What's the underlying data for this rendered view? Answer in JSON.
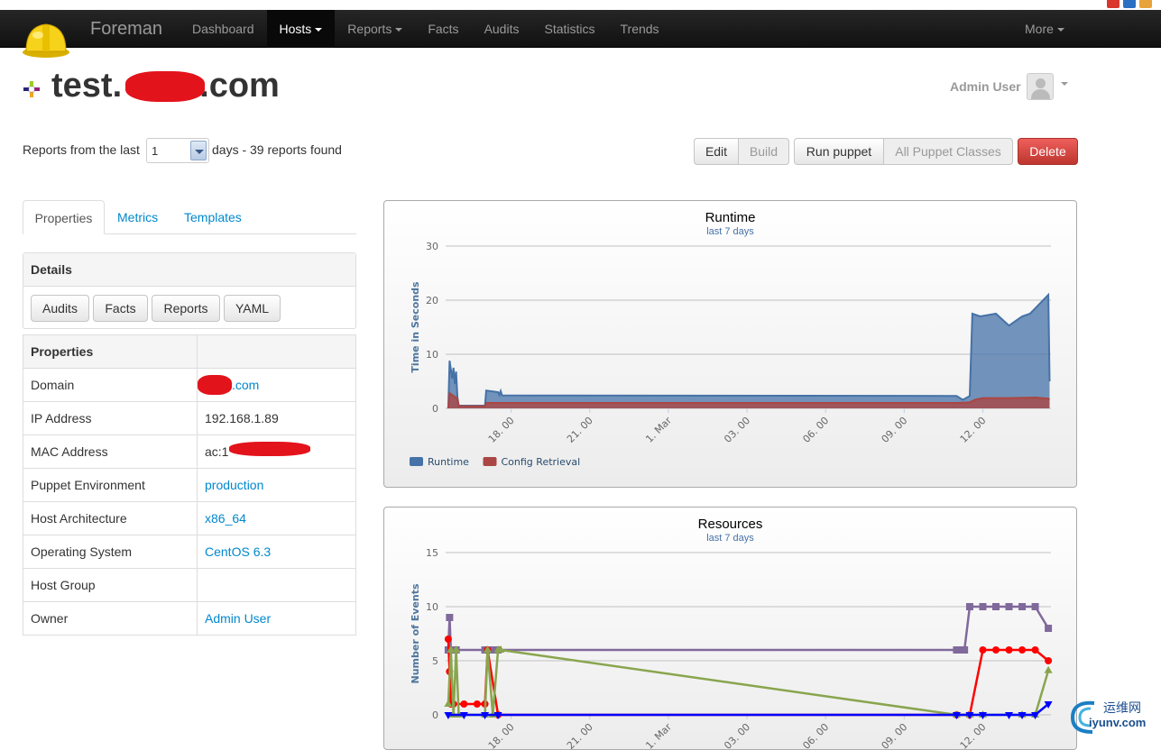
{
  "navbar": {
    "brand": "Foreman",
    "items": [
      {
        "label": "Dashboard",
        "dropdown": false
      },
      {
        "label": "Hosts",
        "dropdown": true,
        "active": true
      },
      {
        "label": "Reports",
        "dropdown": true
      },
      {
        "label": "Facts",
        "dropdown": false
      },
      {
        "label": "Audits",
        "dropdown": false
      },
      {
        "label": "Statistics",
        "dropdown": false
      },
      {
        "label": "Trends",
        "dropdown": false
      }
    ],
    "more": "More"
  },
  "host": {
    "title_prefix": "test.",
    "title_suffix": ".com"
  },
  "user": {
    "name": "Admin User",
    "avatar_icon": "user-avatar-icon"
  },
  "reports_filter": {
    "label": "Reports from the last",
    "value": "1",
    "suffix": "days - 39 reports found"
  },
  "actions": {
    "edit": "Edit",
    "build": "Build",
    "run_puppet": "Run puppet",
    "all_puppet_classes": "All Puppet Classes",
    "delete": "Delete"
  },
  "tabs": [
    "Properties",
    "Metrics",
    "Templates"
  ],
  "details": {
    "heading": "Details",
    "buttons": [
      "Audits",
      "Facts",
      "Reports",
      "YAML"
    ]
  },
  "properties": {
    "heading": "Properties",
    "rows": [
      {
        "key": "Domain",
        "value": ".com",
        "link": true
      },
      {
        "key": "IP Address",
        "value": "192.168.1.89",
        "link": false
      },
      {
        "key": "MAC Address",
        "value": "ac:1",
        "link": false
      },
      {
        "key": "Puppet Environment",
        "value": "production",
        "link": true
      },
      {
        "key": "Host Architecture",
        "value": "x86_64",
        "link": true
      },
      {
        "key": "Operating System",
        "value": "CentOS 6.3",
        "link": true
      },
      {
        "key": "Host Group",
        "value": "",
        "link": false
      },
      {
        "key": "Owner",
        "value": "Admin User",
        "link": true
      }
    ]
  },
  "colors": {
    "runtime": "#4572a7",
    "config_retrieval": "#aa4643",
    "purple": "#80699b",
    "green": "#89a54e",
    "delete": "#da4f49",
    "link": "#0088cc"
  },
  "chart_data": [
    {
      "type": "area",
      "title": "Runtime",
      "subtitle": "last 7 days",
      "ylabel": "Time in Seconds",
      "ylim": [
        0,
        30
      ],
      "yticks": [
        "0",
        "10",
        "20",
        "30"
      ],
      "xticks": [
        "18. 00",
        "21. 00",
        "1. Mar",
        "03. 00",
        "06. 00",
        "09. 00",
        "12. 00"
      ],
      "xrange": [
        15.5,
        38.6
      ],
      "series": [
        {
          "name": "Runtime",
          "x": [
            15.6,
            15.65,
            15.75,
            15.8,
            15.85,
            15.9,
            15.95,
            16.0,
            16.05,
            16.1,
            16.15,
            16.2,
            17.0,
            17.05,
            17.5,
            17.55,
            17.6,
            17.65,
            35.0,
            35.2,
            35.25,
            35.5,
            35.6,
            35.9,
            36.5,
            37.0,
            37.5,
            37.8,
            38.5,
            38.55
          ],
          "y": [
            0,
            8.8,
            5.5,
            7.5,
            4.5,
            6.8,
            2,
            0.5,
            0.5,
            0.5,
            0.5,
            0.5,
            0.5,
            3.3,
            3.0,
            2.5,
            3.2,
            2.4,
            2.3,
            1.7,
            1.6,
            2.3,
            17.5,
            17,
            17.5,
            15.3,
            17,
            17.5,
            21,
            5
          ]
        },
        {
          "name": "Config Retrieval",
          "x": [
            15.6,
            15.65,
            15.8,
            15.95,
            16.0,
            17.0,
            17.05,
            35.0,
            35.5,
            35.7,
            36.0,
            37.0,
            38.0,
            38.5,
            38.55
          ],
          "y": [
            0,
            2.8,
            2.3,
            1.8,
            0.4,
            0.4,
            1.0,
            1.0,
            1.1,
            1.6,
            1.9,
            1.9,
            2.0,
            1.8,
            1.6
          ]
        }
      ],
      "legend": [
        "Runtime",
        "Config Retrieval"
      ]
    },
    {
      "type": "line",
      "title": "Resources",
      "subtitle": "last 7 days",
      "ylabel": "Number of Events",
      "ylim": [
        0,
        15
      ],
      "yticks": [
        "0",
        "5",
        "10",
        "15"
      ],
      "xticks": [
        "18. 00",
        "21. 00",
        "1. Mar",
        "03. 00",
        "06. 00",
        "09. 00",
        "12. 00"
      ],
      "xrange": [
        15.5,
        38.6
      ],
      "series": [
        {
          "name": "",
          "color": "purple",
          "x": [
            15.6,
            15.65,
            15.7,
            15.8,
            15.85,
            15.9,
            17.0,
            17.3,
            17.5,
            35.0,
            35.2,
            35.3,
            35.5,
            36.0,
            36.5,
            37.0,
            37.5,
            38.0,
            38.5
          ],
          "y": [
            6,
            9,
            6,
            6,
            6,
            6,
            6,
            6,
            6,
            6,
            6,
            6,
            10,
            10,
            10,
            10,
            10,
            10,
            8
          ]
        },
        {
          "name": "",
          "color": "red",
          "x": [
            15.6,
            15.65,
            15.7,
            15.8,
            16.2,
            16.7,
            17.0,
            17.1,
            17.5,
            35.0,
            35.5,
            36.0,
            36.5,
            37.0,
            37.5,
            38.0,
            38.5
          ],
          "y": [
            7,
            4,
            1,
            1,
            1,
            1,
            1,
            6,
            0,
            0,
            0,
            6,
            6,
            6,
            6,
            6,
            5
          ]
        },
        {
          "name": "",
          "color": "green",
          "x": [
            15.6,
            15.7,
            15.8,
            15.9,
            16.0,
            17.0,
            17.1,
            17.3,
            17.5,
            17.6,
            35.0,
            35.5,
            36.0,
            37.5,
            38.0,
            38.5
          ],
          "y": [
            1,
            6,
            0,
            6,
            0,
            0,
            6,
            0,
            6,
            6,
            0,
            0,
            0,
            0,
            0,
            4.1
          ]
        },
        {
          "name": "",
          "color": "blue",
          "x": [
            15.6,
            16.2,
            17.0,
            17.5,
            35.0,
            35.5,
            36.0,
            37.0,
            37.5,
            38.0,
            38.5
          ],
          "y": [
            0,
            0,
            0,
            0,
            0,
            0,
            0,
            0,
            0,
            0,
            1
          ]
        }
      ]
    }
  ],
  "watermark": {
    "line1": "运维网",
    "line2": "iyunv.com"
  }
}
